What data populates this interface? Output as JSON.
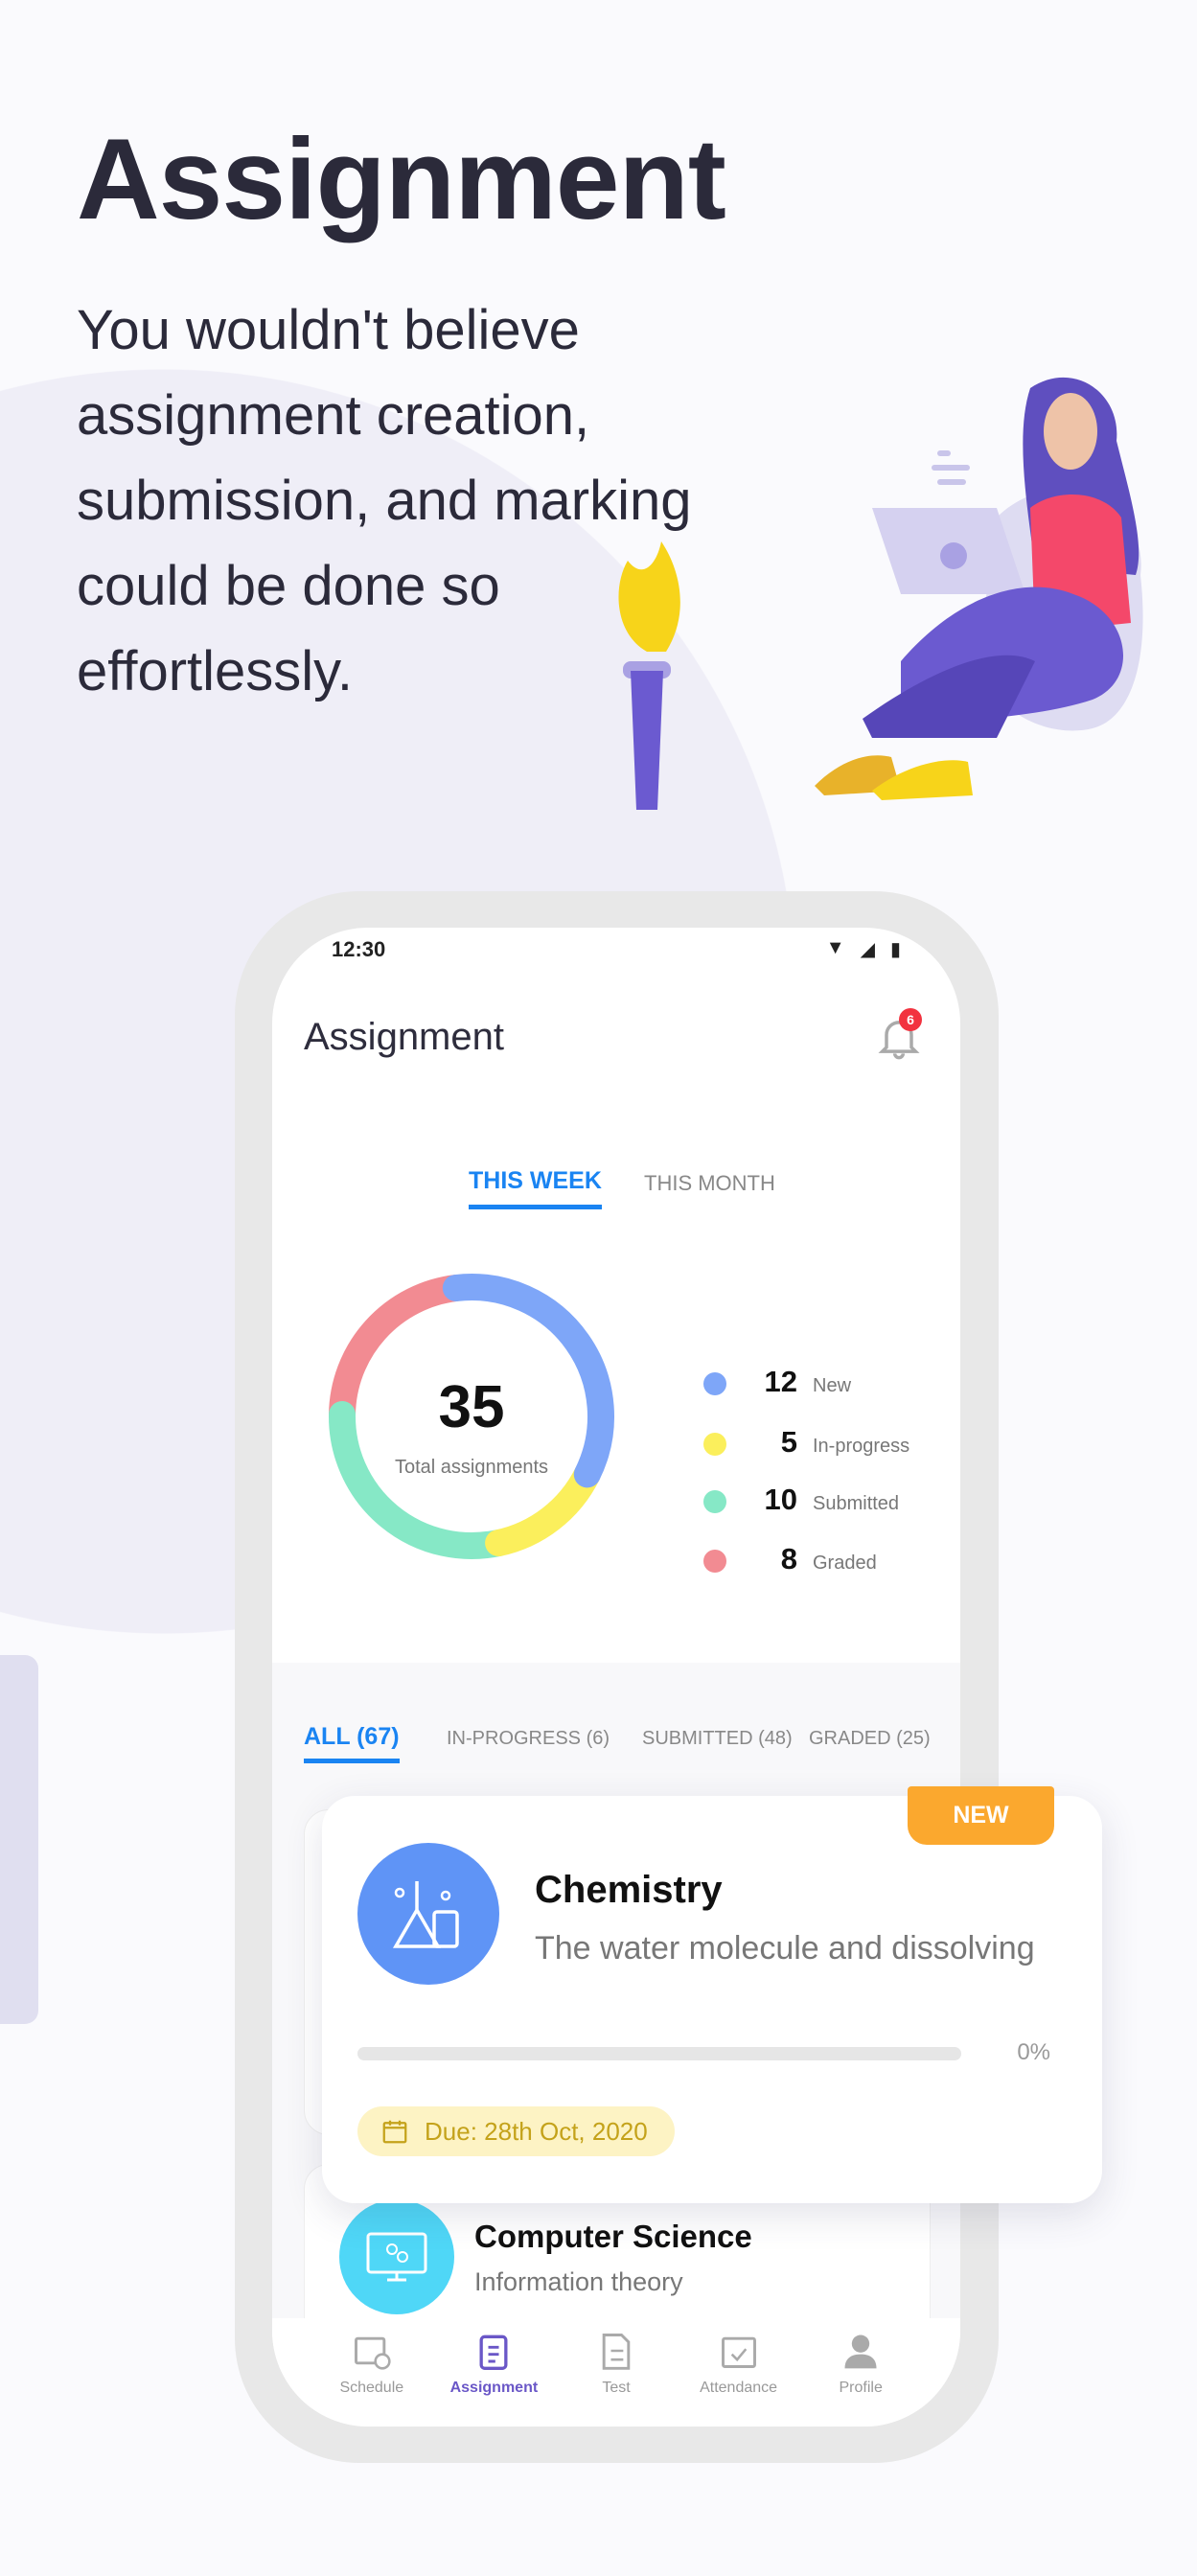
{
  "hero": {
    "title": "Assignment",
    "description": "You wouldn't believe assignment creation, submission, and marking could be done so effortlessly."
  },
  "phone": {
    "status_time": "12:30",
    "app_title": "Assignment",
    "notification_count": "6",
    "period_tabs": [
      {
        "label": "THIS WEEK",
        "active": true
      },
      {
        "label": "THIS MONTH",
        "active": false
      }
    ],
    "summary": {
      "total": "35",
      "total_label": "Total assignments"
    },
    "chart_data": {
      "type": "pie",
      "values": [
        12,
        5,
        10,
        8
      ],
      "categories": [
        "New",
        "In-progress",
        "Submitted",
        "Graded"
      ],
      "colors": [
        "#7ea6f8",
        "#fbef5c",
        "#86e8c6",
        "#f28b92"
      ]
    },
    "legend": [
      {
        "num": "12",
        "label": "New",
        "color": "#7ea6f8"
      },
      {
        "num": "5",
        "label": "In-progress",
        "color": "#fbef5c"
      },
      {
        "num": "10",
        "label": "Submitted",
        "color": "#86e8c6"
      },
      {
        "num": "8",
        "label": "Graded",
        "color": "#f28b92"
      }
    ],
    "filter_tabs": [
      {
        "label": "ALL (67)",
        "active": true
      },
      {
        "label": "IN-PROGRESS (6)"
      },
      {
        "label": "SUBMITTED (48)"
      },
      {
        "label": "GRADED (25)"
      }
    ],
    "featured": {
      "badge": "NEW",
      "subject": "Chemistry",
      "topic": "The water molecule and dissolving",
      "progress": 0,
      "progress_label": "0%",
      "due": "Due: 28th Oct, 2020"
    },
    "next": {
      "subject": "Computer Science",
      "topic": "Information theory"
    },
    "nav": [
      {
        "label": "Schedule"
      },
      {
        "label": "Assignment",
        "active": true
      },
      {
        "label": "Test"
      },
      {
        "label": "Attendance"
      },
      {
        "label": "Profile"
      }
    ]
  },
  "colors": {
    "accent": "#1a84f2",
    "nav_active": "#6a57c7",
    "badge": "#fba82e"
  }
}
